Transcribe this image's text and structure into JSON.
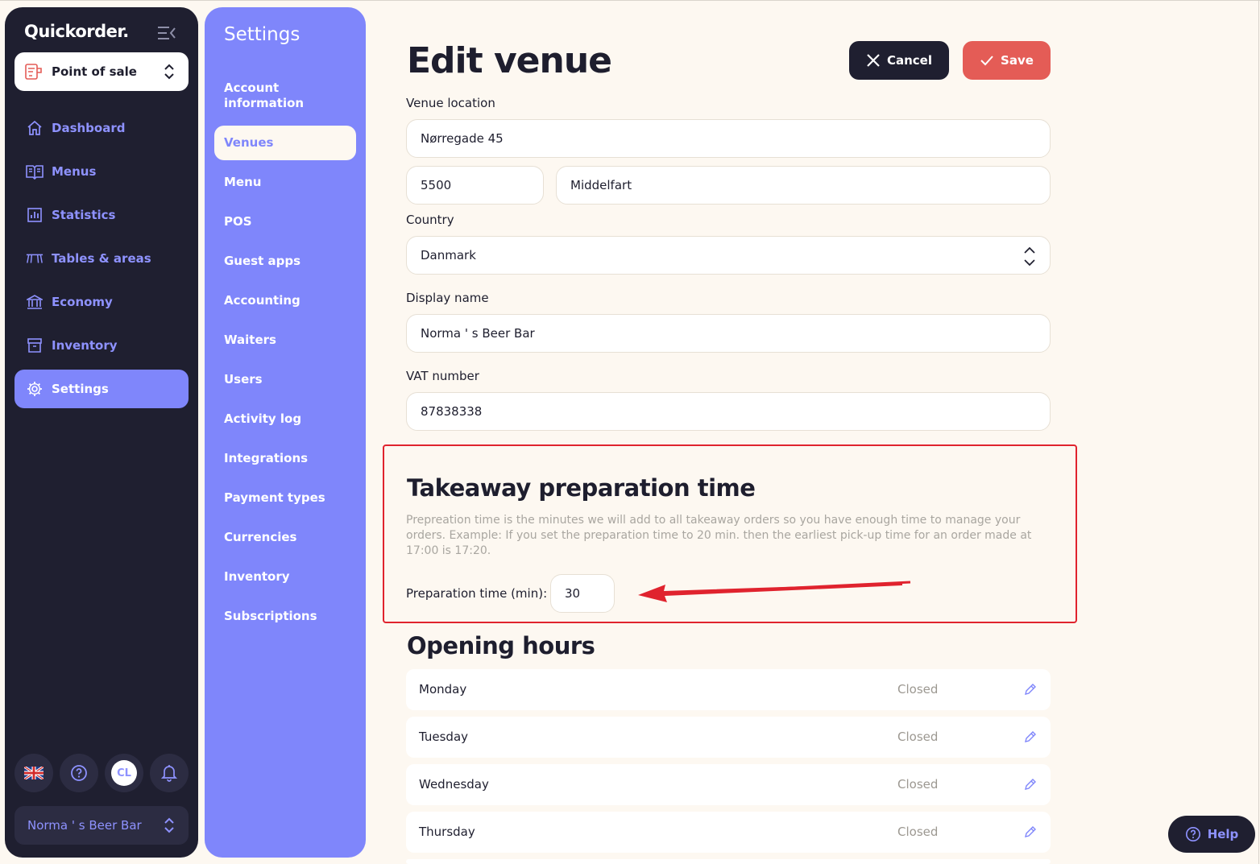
{
  "app": {
    "brand": "Quickorder.",
    "pos_select_label": "Point of sale",
    "nav": [
      {
        "label": "Dashboard",
        "icon": "home-icon"
      },
      {
        "label": "Menus",
        "icon": "book-icon"
      },
      {
        "label": "Statistics",
        "icon": "chart-icon"
      },
      {
        "label": "Tables & areas",
        "icon": "table-icon"
      },
      {
        "label": "Economy",
        "icon": "bank-icon"
      },
      {
        "label": "Inventory",
        "icon": "archive-icon"
      },
      {
        "label": "Settings",
        "icon": "gear-icon",
        "active": true
      }
    ],
    "avatar_initials": "CL",
    "venue_select_label": "Norma ' s Beer Bar"
  },
  "settings": {
    "title": "Settings",
    "items": [
      {
        "label": "Account information"
      },
      {
        "label": "Venues",
        "active": true
      },
      {
        "label": "Menu"
      },
      {
        "label": "POS"
      },
      {
        "label": "Guest apps"
      },
      {
        "label": "Accounting"
      },
      {
        "label": "Waiters"
      },
      {
        "label": "Users"
      },
      {
        "label": "Activity log"
      },
      {
        "label": "Integrations"
      },
      {
        "label": "Payment types"
      },
      {
        "label": "Currencies"
      },
      {
        "label": "Inventory"
      },
      {
        "label": "Subscriptions"
      }
    ]
  },
  "main": {
    "title": "Edit venue",
    "cancel_label": "Cancel",
    "save_label": "Save",
    "venue_location_label": "Venue location",
    "street": "Nørregade 45",
    "zip": "5500",
    "city": "Middelfart",
    "country_label": "Country",
    "country": "Danmark",
    "display_name_label": "Display name",
    "display_name": "Norma ' s Beer Bar",
    "vat_label": "VAT number",
    "vat": "87838338",
    "takeaway_title": "Takeaway preparation time",
    "takeaway_desc": "Prepreation time is the minutes we will add to all takeaway orders so you have enough time to manage your orders. Example: If you set the preparation time to 20 min. then the earliest pick-up time for an order made at 17:00 is 17:20.",
    "prep_label": "Preparation time (min):",
    "prep_value": "30",
    "opening_title": "Opening hours",
    "days": [
      {
        "name": "Monday",
        "status": "Closed"
      },
      {
        "name": "Tuesday",
        "status": "Closed"
      },
      {
        "name": "Wednesday",
        "status": "Closed"
      },
      {
        "name": "Thursday",
        "status": "Closed"
      }
    ],
    "help_label": "Help"
  },
  "colors": {
    "sidebar_bg": "#1f1f30",
    "accent": "#7f86fb",
    "save": "#e45c56",
    "page_bg": "#fdf8f1",
    "annotation": "#e0232e"
  }
}
